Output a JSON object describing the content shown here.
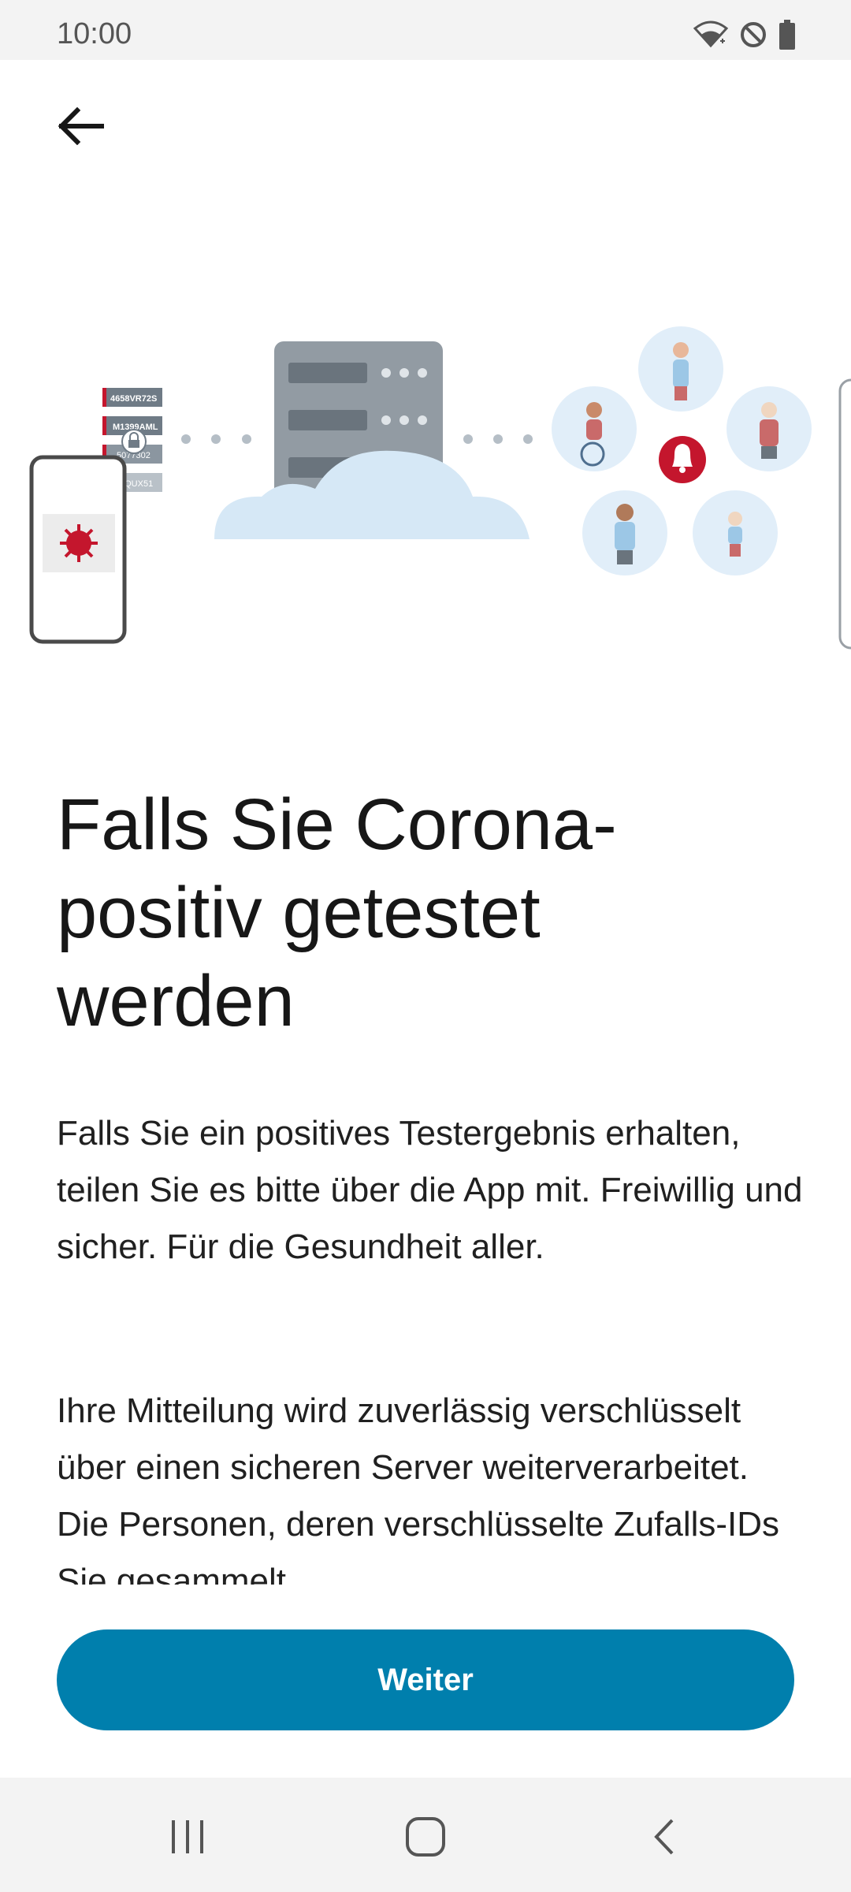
{
  "status_bar": {
    "time": "10:00",
    "icons": [
      "wifi-icon",
      "do-not-disturb-icon",
      "battery-icon"
    ]
  },
  "app_bar": {
    "back_icon": "arrow-left-icon"
  },
  "illustration": {
    "id_labels": [
      "4658VR72S",
      "M1399AML",
      "5077302",
      "4QUX51"
    ]
  },
  "title": "Falls Sie Corona-positiv getestet werden",
  "paragraphs": [
    "Falls Sie ein positives Testergebnis erhalten, teilen Sie es bitte über die App mit. Freiwillig und sicher. Für die Gesundheit aller.",
    "Ihre Mitteilung wird zuverlässig verschlüsselt über einen sicheren Server weiterverarbeitet. Die Personen, deren verschlüsselte Zufalls-IDs Sie gesammelt"
  ],
  "primary_button": {
    "label": "Weiter"
  },
  "nav_bar": {
    "icons": [
      "recents-icon",
      "home-icon",
      "back-icon"
    ]
  },
  "colors": {
    "accent": "#007fad",
    "virus_red": "#c4162d",
    "server_gray": "#929ba3",
    "cloud_blue": "#d6e8f6"
  }
}
